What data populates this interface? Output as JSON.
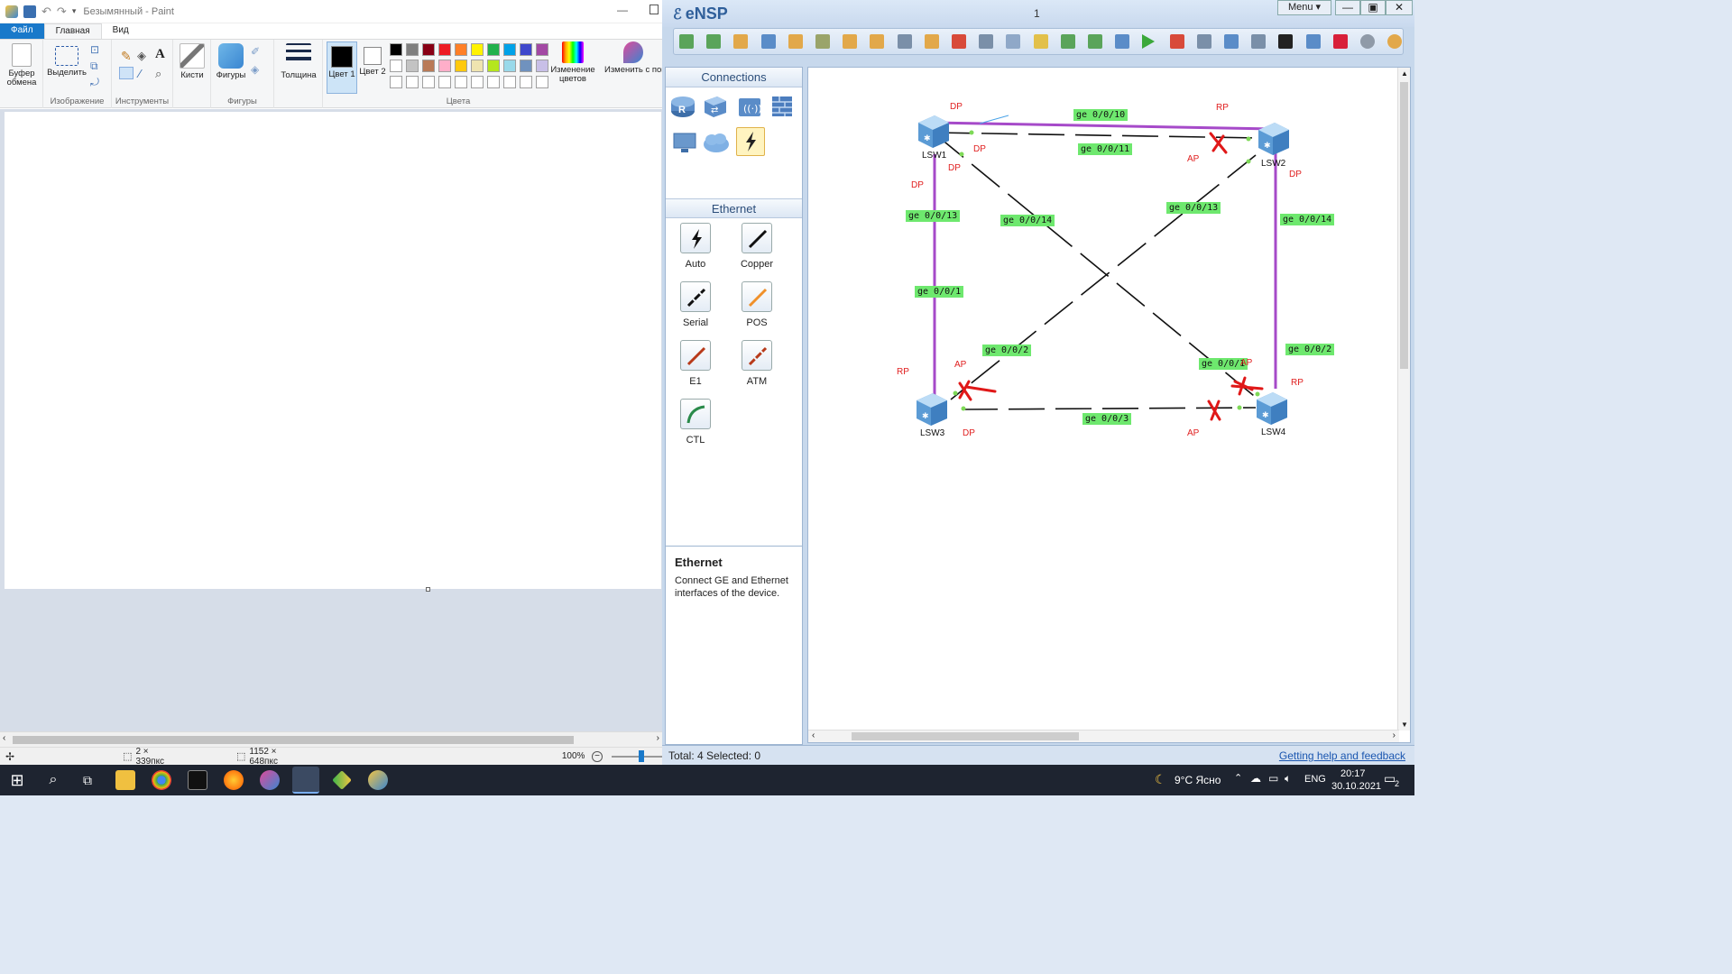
{
  "paint": {
    "title": "Безымянный - Paint",
    "tabs": [
      "Файл",
      "Главная",
      "Вид"
    ],
    "groups": {
      "image": "Изображение",
      "tools": "Инструменты",
      "shapes": "Фигуры",
      "colors": "Цвета"
    },
    "buttons": {
      "clipboard": "Буфер обмена",
      "select": "Выделить",
      "brushes": "Кисти",
      "shapes": "Фигуры",
      "size": "Толщина",
      "color1": "Цвет 1",
      "color2": "Цвет 2",
      "edit_colors": "Изменение цветов",
      "paint3d": "Изменить с помощью Pai"
    },
    "palette_row1": [
      "#000000",
      "#7f7f7f",
      "#880015",
      "#ed1c24",
      "#ff7f27",
      "#fff200",
      "#22b14c",
      "#00a2e8",
      "#3f48cc",
      "#a349a4"
    ],
    "palette_row2": [
      "#ffffff",
      "#c3c3c3",
      "#b97a57",
      "#ffaec9",
      "#ffc90e",
      "#efe4b0",
      "#b5e61d",
      "#99d9ea",
      "#7092be",
      "#c8bfe7"
    ],
    "status": {
      "selection": "2 × 339пкс",
      "size": "1152 × 648пкс",
      "zoom": "100%"
    }
  },
  "ensp": {
    "title": "eNSP",
    "window_number": "1",
    "menu": "Menu",
    "connections_header": "Connections",
    "ethernet_header": "Ethernet",
    "cables": [
      "Auto",
      "Copper",
      "Serial",
      "POS",
      "E1",
      "ATM",
      "CTL"
    ],
    "desc_title": "Ethernet",
    "desc_text": "Connect GE and Ethernet interfaces of the device.",
    "status_left": "Total: 4  Selected: 0",
    "help_link": "Getting help and feedback",
    "switches": [
      "LSW1",
      "LSW2",
      "LSW3",
      "LSW4"
    ],
    "ports": {
      "p1": "ge 0/0/10",
      "p2": "ge 0/0/11",
      "p3": "ge 0/0/13",
      "p4": "ge 0/0/14",
      "p5": "ge 0/0/13",
      "p6": "ge 0/0/14",
      "p7": "ge 0/0/1",
      "p8": "ge 0/0/2",
      "p9": "ge 0/0/1",
      "p10": "ge 0/0/2",
      "p11": "ge 0/0/3"
    },
    "roles": {
      "dp": "DP",
      "rp": "RP",
      "ap": "AP"
    }
  },
  "taskbar": {
    "weather": "9°C  Ясно",
    "lang": "ENG",
    "time": "20:17",
    "date": "30.10.2021",
    "notifications": "2"
  }
}
